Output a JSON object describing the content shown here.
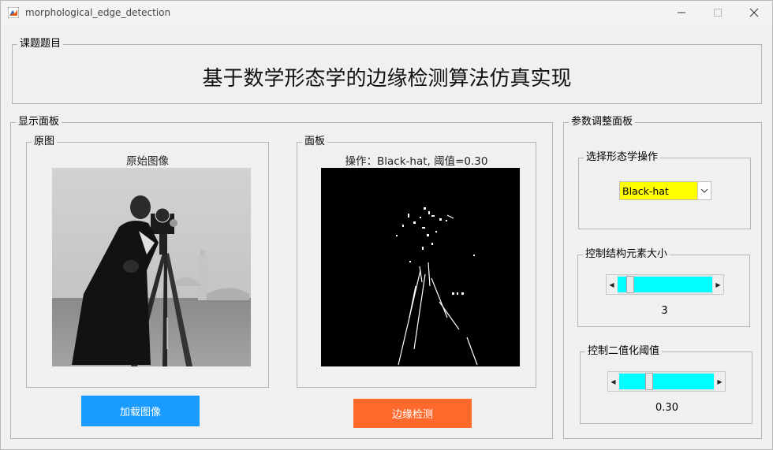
{
  "window": {
    "title": "morphological_edge_detection"
  },
  "topic_panel": {
    "legend": "课题题目",
    "heading": "基于数学形态学的边缘检测算法仿真实现"
  },
  "display_panel": {
    "legend": "显示面板",
    "original": {
      "legend": "原图",
      "caption": "原始图像"
    },
    "result": {
      "legend": "面板",
      "caption": "操作：Black-hat, 阈值=0.30"
    },
    "load_button": "加载图像",
    "detect_button": "边缘检测"
  },
  "param_panel": {
    "legend": "参数调整面板",
    "operation": {
      "legend": "选择形态学操作",
      "selected": "Black-hat"
    },
    "se_size": {
      "legend": "控制结构元素大小",
      "value": "3",
      "level": 0.1
    },
    "threshold": {
      "legend": "控制二值化阈值",
      "value": "0.30",
      "level": 0.3
    }
  },
  "colors": {
    "load_button": "#1a9bff",
    "detect_button": "#ff6a2c",
    "dropdown": "#ffff00",
    "slider": "#00ffff"
  }
}
